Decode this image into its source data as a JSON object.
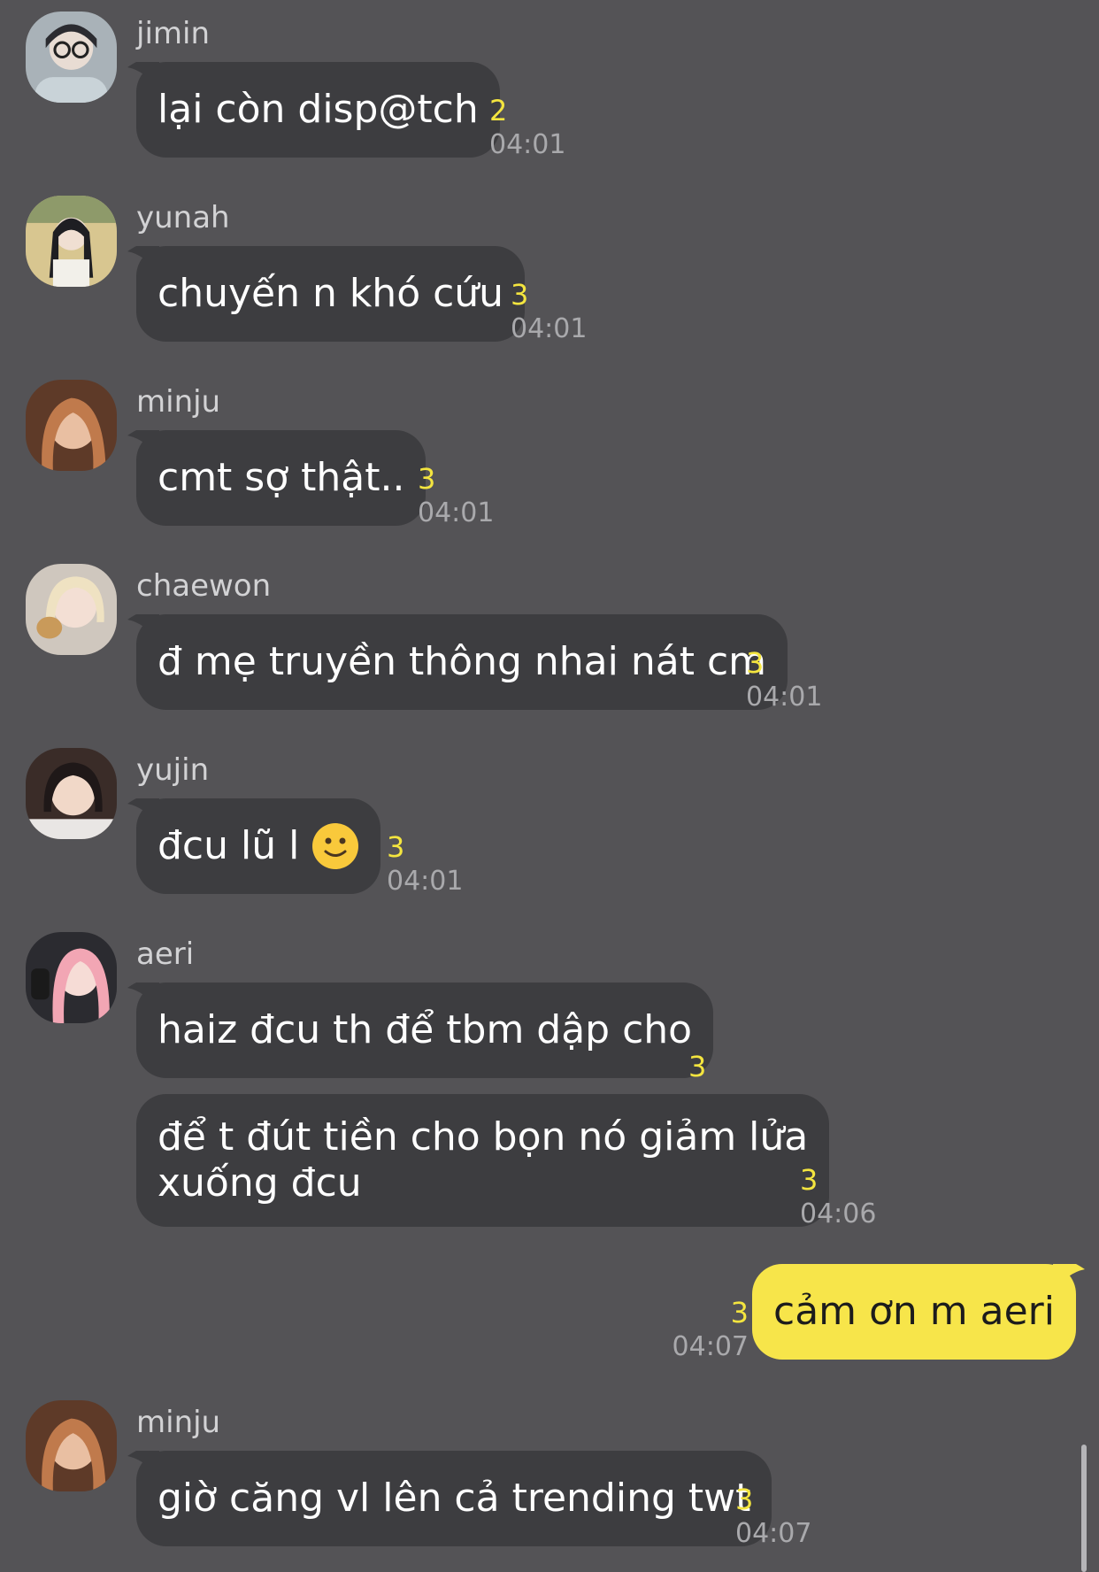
{
  "messages": [
    {
      "sender": "jimin",
      "text": "lại còn disp@tch",
      "unread": "2",
      "time": "04:01"
    },
    {
      "sender": "yunah",
      "text": "chuyến n khó cứu",
      "unread": "3",
      "time": "04:01"
    },
    {
      "sender": "minju",
      "text": "cmt sợ thật..",
      "unread": "3",
      "time": "04:01"
    },
    {
      "sender": "chaewon",
      "text": "đ mẹ truyền thông nhai nát cm",
      "unread": "3",
      "time": "04:01"
    },
    {
      "sender": "yujin",
      "text": "đcu lũ l",
      "emoji": "slightly-smiling-face",
      "unread": "3",
      "time": "04:01"
    },
    {
      "sender": "aeri",
      "text": "haiz đcu th để tbm dập cho",
      "unread": "3",
      "time": ""
    },
    {
      "sender": "aeri",
      "text_line1": "để t đút tiền cho bọn nó giảm lửa",
      "text_line2": "xuống đcu",
      "unread": "3",
      "time": "04:06"
    },
    {
      "sender": "me",
      "text": "cảm ơn m aeri",
      "unread": "3",
      "time": "04:07"
    },
    {
      "sender": "minju",
      "text": "giờ căng vl lên cả trending twt",
      "unread": "3",
      "time": "04:07"
    }
  ],
  "colors": {
    "background": "#545356",
    "incoming_bubble": "#3d3d40",
    "outgoing_bubble": "#f7e54a",
    "unread_count": "#f4e53f",
    "timestamp": "#a9a9ac"
  }
}
